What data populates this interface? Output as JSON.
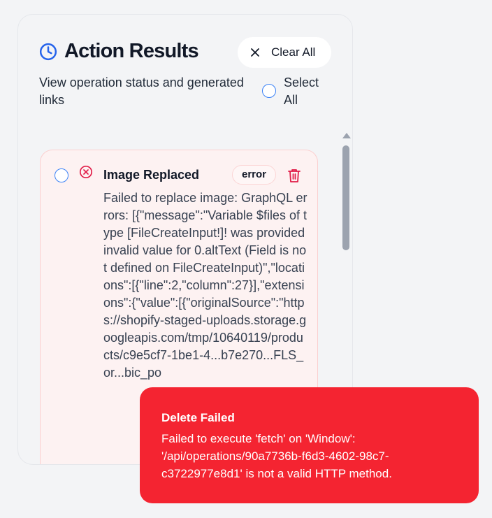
{
  "header": {
    "title": "Action Results",
    "subtitle": "View operation status and generated links",
    "clear_all_label": "Clear All",
    "select_all_label": "Select All"
  },
  "icons": {
    "header": "clock-icon",
    "clear": "close-icon",
    "status": "error-circle-icon",
    "delete": "trash-icon"
  },
  "results": [
    {
      "title": "Image Replaced",
      "status": "error",
      "message": "Failed to replace image: GraphQL errors: [{\"message\":\"Variable $files of type [FileCreateInput!]! was provided invalid value for 0.altText (Field is not defined on FileCreateInput)\",\"locations\":[{\"line\":2,\"column\":27}],\"extensions\":{\"value\":[{\"originalSource\":\"https://shopify-staged-uploads.storage.googleapis.com/tmp/10640119/products/c9e5cf7-1be1-4...b7e270...FLS_or...bic_po"
    }
  ],
  "toast": {
    "title": "Delete Failed",
    "message": "Failed to execute 'fetch' on 'Window': '/api/operations/90a7736b-f6d3-4602-98c7-c3722977e8d1' is not a valid HTTP method."
  },
  "colors": {
    "accent_blue": "#3b82f6",
    "error_red": "#e11d48",
    "toast_bg": "#f42431",
    "card_bg": "#fdf2f2"
  }
}
